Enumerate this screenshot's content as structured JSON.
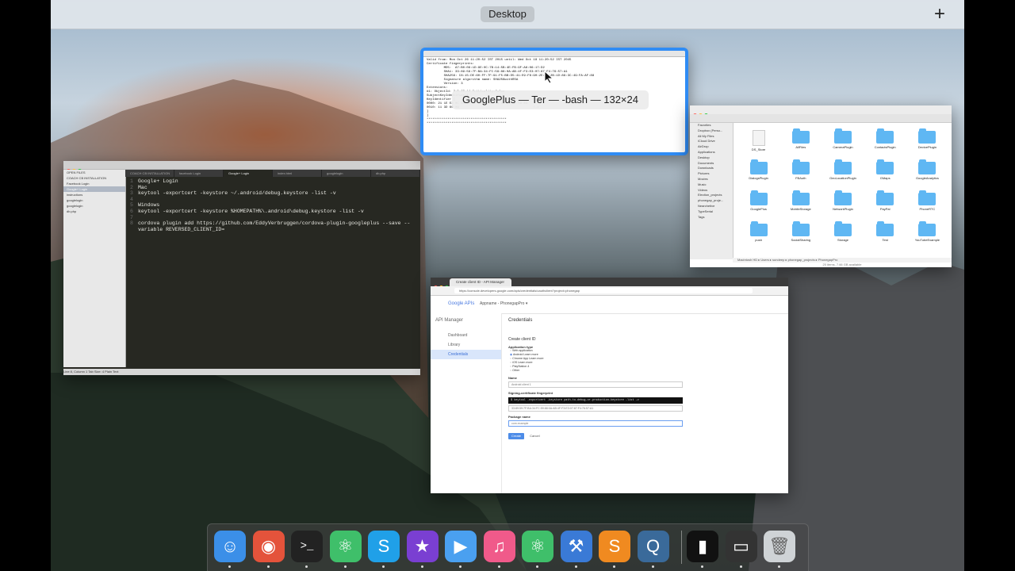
{
  "spaces_bar": {
    "title": "Desktop",
    "add_label": "+"
  },
  "terminal": {
    "title": "GooglePlus — Ter — -bash — 132×24",
    "lines": [
      "Valid from: Mon Oct 26 11:20:52 IST 2015 until: Wed Oct 18 11:20:52 IST 2045",
      "Certificate fingerprints:",
      "         MD5:  A7:B0:09:1D:9E:0C:7B:14:5B:4E:FB:9F:A8:06:17:D2",
      "         SHA1: 33:89:59:7F:BA:34:FC:59:88:0A:AB:4F:F3:E3:07:87:F4:76:57:A1",
      "         SHA256: C8:15:DE:60:FF:7F:91:F5:BB:D5:41:E9:F8:90:2E:F9:2B:1D:89:3C:49:FA:AF:88",
      "         Signature algorithm name: SHA256withRSA",
      "         Version: 3",
      "",
      "Extensions:",
      "",
      "#1: ObjectId: 2.5.29.14 Criticality=false",
      "SubjectKeyIdentifier [",
      "KeyIdentifier [",
      "0000: 21 1E E3 0C 63 9A 5E 54 8A 6B 51 84 28 0E 59 83",
      "0010: 11 3D 60 09                                       !.=`.",
      "]",
      "]",
      "",
      "",
      "",
      "******************************************",
      "******************************************"
    ]
  },
  "editor": {
    "title": "Google+ Login",
    "sidebar": [
      "OPEN FILES",
      "COACH CB INSTALLATION",
      "Facebook Login",
      "Google+ Login",
      "instructions",
      "googlelogin",
      "googlelogin",
      "db.php"
    ],
    "tabs": [
      "COACH CB INSTALLATION",
      "facebook Login",
      "Google+ Login",
      "index.html",
      "googlelogin",
      "db.php"
    ],
    "code": [
      {
        "n": "1",
        "t": "Google+ Login"
      },
      {
        "n": "2",
        "t": "Mac"
      },
      {
        "n": "3",
        "t": "keytool -exportcert -keystore ~/.android/debug.keystore -list -v"
      },
      {
        "n": "4",
        "t": ""
      },
      {
        "n": "5",
        "t": "Windows"
      },
      {
        "n": "6",
        "t": "keytool -exportcert -keystore %HOMEPATH%\\.android\\debug.keystore -list -v"
      },
      {
        "n": "7",
        "t": ""
      },
      {
        "n": "8",
        "t": "cordova plugin add https://github.com/EddyVerbruggen/cordova-plugin-googleplus --save --"
      },
      {
        "n": "",
        "t": "variable REVERSED_CLIENT_ID="
      }
    ],
    "status": "Line 8, Column 1                                                                                            Tab Size: 4                      Plain Text"
  },
  "finder": {
    "title": "PhonegapPro",
    "sidebar": [
      "Favorites",
      "Dropbox (Perso...",
      "All My Files",
      "iCloud Drive",
      "AirDrop",
      "Applications",
      "Desktop",
      "Documents",
      "Downloads",
      "Pictures",
      "Movies",
      "Music",
      "Videos",
      "Election_projects",
      "phonegap_proje...",
      "Nearchetive",
      "TypeSerial",
      "Tags"
    ],
    "items": [
      "DS_Store",
      "AllFiles",
      "CameraPlugin",
      "ContactsPlugin",
      "DevicePlugin",
      "DialogsPlugin",
      "FBAuth",
      "GeoLocationPlugin",
      "GMaps",
      "GoogleAnalytics",
      "GooglePlus",
      "MobileStorage",
      "NetworkPlugin",
      "PayPal",
      "PhoneRTC",
      "push",
      "SocialSharing",
      "Storage",
      "Test",
      "YouTubeExample"
    ],
    "path": "Macintosh HD  ▸  Users  ▸  sundeep  ▸  phonegap_projects  ▸  PhonegapPro",
    "status": "20 items, 7.66 GB available"
  },
  "chrome": {
    "tab_title": "Create client ID - API Manager",
    "url": "https://console.developers.google.com/apis/credentials/oauthclient?project=phonegap",
    "logo": "Google APIs",
    "project": "Appname - PhonegapPro ▾",
    "api_manager": "API Manager",
    "nav": [
      "Dashboard",
      "Library",
      "Credentials"
    ],
    "heading": "Credentials",
    "form": {
      "title": "Create client ID",
      "app_type_label": "Application type",
      "options": [
        "Web application",
        "Android  Learn more",
        "Chrome App  Learn more",
        "iOS  Learn more",
        "PlayStation 4",
        "Other"
      ],
      "name_label": "Name",
      "name_value": "Android client 1",
      "fingerprint_label": "Signing-certificate fingerprint",
      "fingerprint_cmd": "$ keytool -exportcert -keystore path-to-debug-or-production-keystore -list -v",
      "fingerprint_value": "33:89:59:7F:BA:34:FC:59:88:0A:AB:4F:F3:E3:07:87:F4:76:57:A1",
      "package_label": "Package name",
      "package_placeholder": "com.example",
      "create": "Create",
      "cancel": "Cancel"
    }
  },
  "dock": {
    "apps": [
      {
        "name": "finder",
        "glyph": "☺",
        "color": "#3b8fe8"
      },
      {
        "name": "chrome",
        "glyph": "◉",
        "color": "#e4533b"
      },
      {
        "name": "terminal",
        "glyph": ">_",
        "color": "#222"
      },
      {
        "name": "atom",
        "glyph": "⚛",
        "color": "#3fbf6a"
      },
      {
        "name": "skype",
        "glyph": "S",
        "color": "#20a0e8"
      },
      {
        "name": "imovie",
        "glyph": "★",
        "color": "#7a3fd2"
      },
      {
        "name": "quicktime",
        "glyph": "▶",
        "color": "#4aa0f0"
      },
      {
        "name": "itunes",
        "glyph": "♫",
        "color": "#f05a8a"
      },
      {
        "name": "atom-2",
        "glyph": "⚛",
        "color": "#3fbf6a"
      },
      {
        "name": "xcode",
        "glyph": "⚒",
        "color": "#3a7ad6"
      },
      {
        "name": "sublime-text",
        "glyph": "S",
        "color": "#f08a20"
      },
      {
        "name": "quicktime-x",
        "glyph": "Q",
        "color": "#3a6a9a"
      },
      {
        "name": "phone-doc",
        "glyph": "▮",
        "color": "#111"
      },
      {
        "name": "window-doc",
        "glyph": "▭",
        "color": "#333"
      },
      {
        "name": "trash",
        "glyph": "🗑",
        "color": "#cfd3d6"
      }
    ]
  }
}
